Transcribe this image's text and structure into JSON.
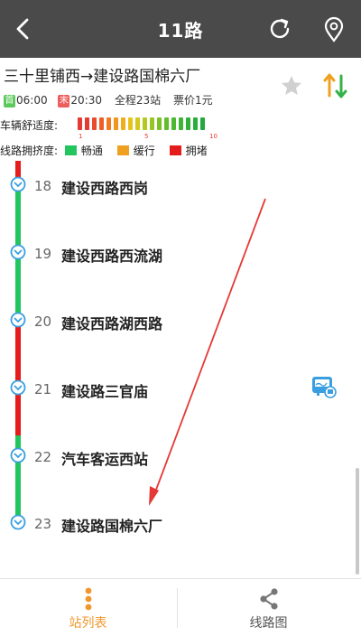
{
  "header": {
    "title": "11路",
    "back_icon": "chevron-left-icon",
    "refresh_icon": "refresh-icon",
    "location_icon": "map-pin-icon"
  },
  "route": {
    "name": "三十里铺西→建设路国棉六厂",
    "first_tag": "首",
    "first_time": "06:00",
    "last_tag": "末",
    "last_time": "20:30",
    "stops_total": "全程23站",
    "fare": "票价1元",
    "favorite_icon": "star-icon",
    "switch_icon": "swap-direction-icon"
  },
  "legend": {
    "comfort_label": "车辆舒适度:",
    "comfort_scale": [
      "1",
      "5",
      "10"
    ],
    "congestion_label": "线路拥挤度:",
    "levels": [
      {
        "label": "畅通",
        "color": "#22c55e"
      },
      {
        "label": "缓行",
        "color": "#f0a020"
      },
      {
        "label": "拥堵",
        "color": "#e51c1c"
      }
    ]
  },
  "stations": [
    {
      "num": "18",
      "name": "建设西路西岗"
    },
    {
      "num": "19",
      "name": "建设西路西流湖"
    },
    {
      "num": "20",
      "name": "建设西路湖西路"
    },
    {
      "num": "21",
      "name": "建设路三官庙"
    },
    {
      "num": "22",
      "name": "汽车客运西站"
    },
    {
      "num": "23",
      "name": "建设路国棉六厂"
    }
  ],
  "tabs": [
    {
      "label": "站列表",
      "icon": "list-dots-icon",
      "active": true
    },
    {
      "label": "线路图",
      "icon": "share-network-icon",
      "active": false
    }
  ],
  "colors": {
    "header_bg": "#4a4a4a",
    "accent": "#f0972a",
    "station_dot": "#3a9fe0"
  }
}
